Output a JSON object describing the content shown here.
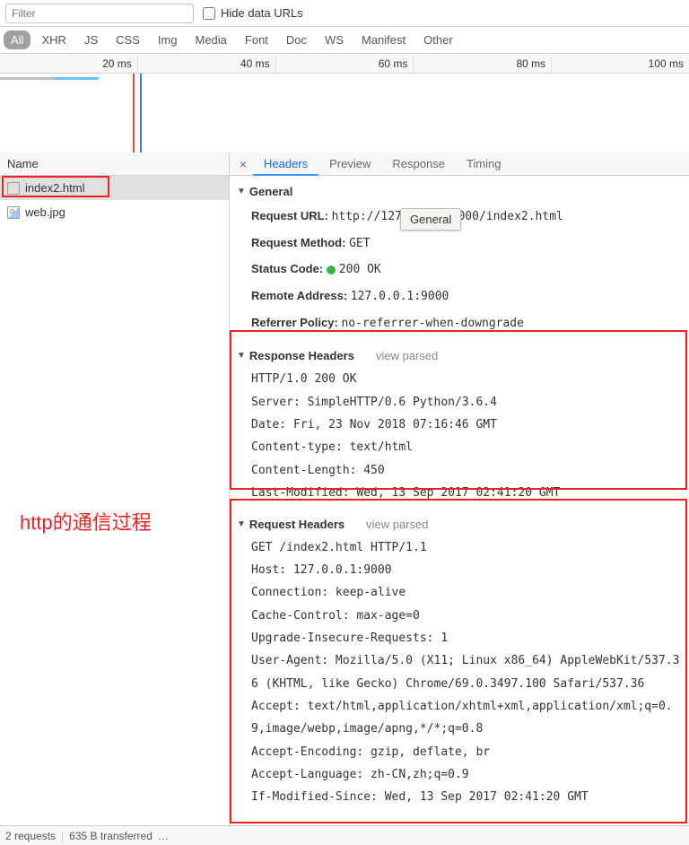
{
  "filter": {
    "placeholder": "Filter",
    "hide_urls_label": "Hide data URLs"
  },
  "type_tabs": [
    "All",
    "XHR",
    "JS",
    "CSS",
    "Img",
    "Media",
    "Font",
    "Doc",
    "WS",
    "Manifest",
    "Other"
  ],
  "type_tab_active": 0,
  "timeline_labels": [
    "20 ms",
    "40 ms",
    "60 ms",
    "80 ms",
    "100 ms"
  ],
  "files_header": "Name",
  "files": [
    {
      "name": "index2.html",
      "selected": true,
      "type": "doc"
    },
    {
      "name": "web.jpg",
      "selected": false,
      "type": "img"
    }
  ],
  "annotation": "http的通信过程",
  "detail_tabs": [
    "Headers",
    "Preview",
    "Response",
    "Timing"
  ],
  "detail_tab_active": 0,
  "tooltip": "General",
  "general": {
    "title": "General",
    "request_url_k": "Request URL:",
    "request_url_v": "http://127.0.0.1:9000/index2.html",
    "request_method_k": "Request Method:",
    "request_method_v": "GET",
    "status_code_k": "Status Code:",
    "status_code_v": "200 OK",
    "remote_addr_k": "Remote Address:",
    "remote_addr_v": "127.0.0.1:9000",
    "referrer_k": "Referrer Policy:",
    "referrer_v": "no-referrer-when-downgrade"
  },
  "response_headers": {
    "title": "Response Headers",
    "view_parsed": "view parsed",
    "lines": [
      "HTTP/1.0 200 OK",
      "Server: SimpleHTTP/0.6 Python/3.6.4",
      "Date: Fri, 23 Nov 2018 07:16:46 GMT",
      "Content-type: text/html",
      "Content-Length: 450",
      "Last-Modified: Wed, 13 Sep 2017 02:41:20 GMT"
    ]
  },
  "request_headers": {
    "title": "Request Headers",
    "view_parsed": "view parsed",
    "lines": [
      "GET /index2.html HTTP/1.1",
      "Host: 127.0.0.1:9000",
      "Connection: keep-alive",
      "Cache-Control: max-age=0",
      "Upgrade-Insecure-Requests: 1",
      "User-Agent: Mozilla/5.0 (X11; Linux x86_64) AppleWebKit/537.36 (KHTML, like Gecko) Chrome/69.0.3497.100 Safari/537.36",
      "Accept: text/html,application/xhtml+xml,application/xml;q=0.9,image/webp,image/apng,*/*;q=0.8",
      "Accept-Encoding: gzip, deflate, br",
      "Accept-Language: zh-CN,zh;q=0.9",
      "If-Modified-Since: Wed, 13 Sep 2017 02:41:20 GMT"
    ]
  },
  "status_bar": {
    "requests": "2 requests",
    "transferred": "635 B transferred",
    "dots": "…"
  }
}
